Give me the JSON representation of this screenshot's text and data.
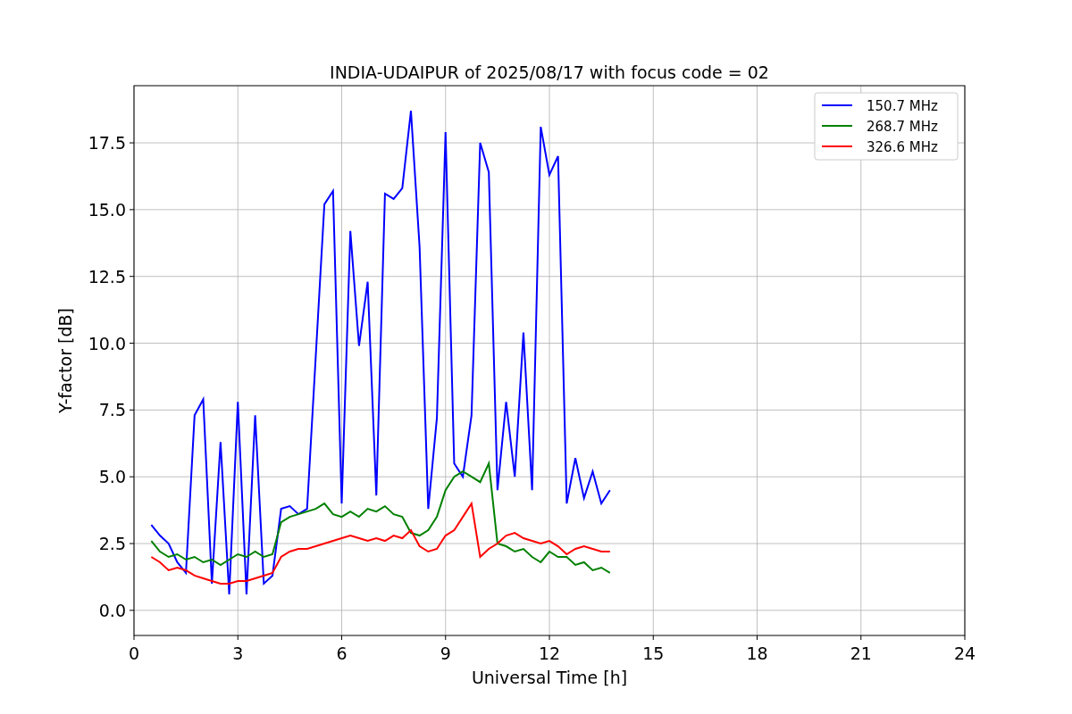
{
  "chart_data": {
    "type": "line",
    "title": "INDIA-UDAIPUR of 2025/08/17 with focus code = 02",
    "xlabel": "Universal Time [h]",
    "ylabel": "Y-factor [dB]",
    "x": [
      0.5,
      0.75,
      1,
      1.25,
      1.5,
      1.75,
      2,
      2.25,
      2.5,
      2.75,
      3,
      3.25,
      3.5,
      3.75,
      4,
      4.25,
      4.5,
      4.75,
      5,
      5.25,
      5.5,
      5.75,
      6,
      6.25,
      6.5,
      6.75,
      7,
      7.25,
      7.5,
      7.75,
      8,
      8.25,
      8.5,
      8.75,
      9,
      9.25,
      9.5,
      9.75,
      10,
      10.25,
      10.5,
      10.75,
      11,
      11.25,
      11.5,
      11.75,
      12,
      12.25,
      12.5,
      12.75,
      13,
      13.25,
      13.5,
      13.75
    ],
    "series": [
      {
        "name": "150.7 MHz",
        "color": "#0000ff",
        "values": [
          3.2,
          2.8,
          2.5,
          1.8,
          1.4,
          7.3,
          7.9,
          1.0,
          6.3,
          0.6,
          7.8,
          0.6,
          7.3,
          1.0,
          1.3,
          3.8,
          3.9,
          3.6,
          3.8,
          9.5,
          15.2,
          15.7,
          4.0,
          14.2,
          9.9,
          12.3,
          4.3,
          15.6,
          15.4,
          15.8,
          18.7,
          13.6,
          3.8,
          7.2,
          17.9,
          5.5,
          5.0,
          7.3,
          17.5,
          16.4,
          4.5,
          7.8,
          5.0,
          10.4,
          4.5,
          18.1,
          16.3,
          17.0,
          4.0,
          5.7,
          4.2,
          5.2,
          4.0,
          4.5
        ]
      },
      {
        "name": "268.7 MHz",
        "color": "#008000",
        "values": [
          2.6,
          2.2,
          2.0,
          2.1,
          1.9,
          2.0,
          1.8,
          1.9,
          1.7,
          1.9,
          2.1,
          2.0,
          2.2,
          2.0,
          2.1,
          3.3,
          3.5,
          3.6,
          3.7,
          3.8,
          4.0,
          3.6,
          3.5,
          3.7,
          3.5,
          3.8,
          3.7,
          3.9,
          3.6,
          3.5,
          2.9,
          2.8,
          3.0,
          3.5,
          4.5,
          5.0,
          5.2,
          5.0,
          4.8,
          5.5,
          2.5,
          2.4,
          2.2,
          2.3,
          2.0,
          1.8,
          2.2,
          2.0,
          2.0,
          1.7,
          1.8,
          1.5,
          1.6,
          1.4
        ]
      },
      {
        "name": "326.6 MHz",
        "color": "#ff0000",
        "values": [
          2.0,
          1.8,
          1.5,
          1.6,
          1.5,
          1.3,
          1.2,
          1.1,
          1.0,
          1.0,
          1.1,
          1.1,
          1.2,
          1.3,
          1.4,
          2.0,
          2.2,
          2.3,
          2.3,
          2.4,
          2.5,
          2.6,
          2.7,
          2.8,
          2.7,
          2.6,
          2.7,
          2.6,
          2.8,
          2.7,
          3.0,
          2.4,
          2.2,
          2.3,
          2.8,
          3.0,
          3.5,
          4.0,
          2.0,
          2.3,
          2.5,
          2.8,
          2.9,
          2.7,
          2.6,
          2.5,
          2.6,
          2.4,
          2.1,
          2.3,
          2.4,
          2.3,
          2.2,
          2.2
        ]
      }
    ],
    "grid": true,
    "legend": true,
    "xlim": [
      0,
      24
    ],
    "ylim": [
      -0.94,
      19.64
    ],
    "xticks": [
      0,
      3,
      6,
      9,
      12,
      15,
      18,
      21,
      24
    ],
    "yticks": [
      {
        "value": 0,
        "label": "0.0"
      },
      {
        "value": 2.5,
        "label": "2.5"
      },
      {
        "value": 5,
        "label": "5.0"
      },
      {
        "value": 7.5,
        "label": "7.5"
      },
      {
        "value": 10,
        "label": "10.0"
      },
      {
        "value": 12.5,
        "label": "12.5"
      },
      {
        "value": 15,
        "label": "15.0"
      },
      {
        "value": 17.5,
        "label": "17.5"
      }
    ]
  }
}
